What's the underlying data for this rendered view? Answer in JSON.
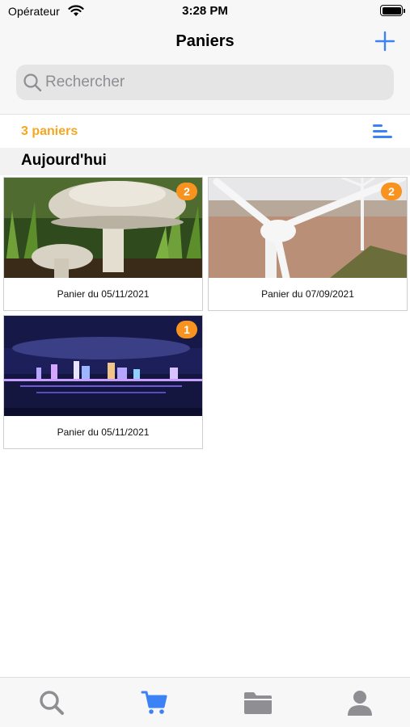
{
  "status_bar": {
    "carrier": "Opérateur",
    "time": "3:28 PM"
  },
  "nav": {
    "title": "Paniers",
    "add_icon": "plus-icon"
  },
  "search": {
    "placeholder": "Rechercher",
    "value": ""
  },
  "toolbar": {
    "count_label": "3 paniers",
    "sort_icon": "sort-lines-icon"
  },
  "section": {
    "title": "Aujourd'hui"
  },
  "baskets": [
    {
      "caption": "Panier du 05/11/2021",
      "badge": "2",
      "image": "mushroom-photo"
    },
    {
      "caption": "Panier du 07/09/2021",
      "badge": "2",
      "image": "wind-turbine-photo"
    },
    {
      "caption": "Panier du 05/11/2021",
      "badge": "1",
      "image": "city-skyline-night-photo"
    }
  ],
  "tabs": [
    {
      "icon": "search-icon",
      "active": false
    },
    {
      "icon": "cart-icon",
      "active": true
    },
    {
      "icon": "folder-icon",
      "active": false
    },
    {
      "icon": "user-icon",
      "active": false
    }
  ],
  "colors": {
    "accent": "#3b82f6",
    "badge": "#f7931e",
    "count_label": "#f5a623",
    "inactive_tab": "#8e8e93"
  }
}
